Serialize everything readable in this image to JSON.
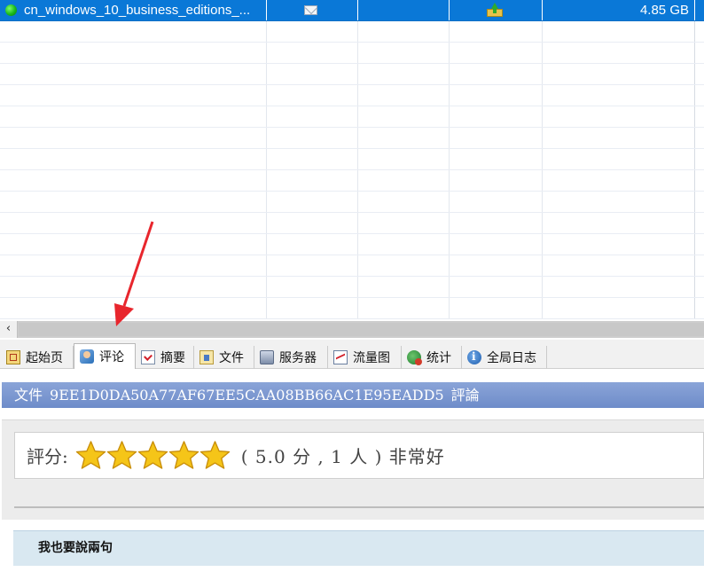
{
  "file_list": {
    "selected_row": {
      "name": "cn_windows_10_business_editions_...",
      "size": "4.85 GB"
    },
    "empty_row_count": 14
  },
  "tabs": [
    {
      "label": "起始页",
      "icon": "home-page-icon",
      "active": false
    },
    {
      "label": "评论",
      "icon": "comment-user-icon",
      "active": true
    },
    {
      "label": "摘要",
      "icon": "summary-checklist-icon",
      "active": false
    },
    {
      "label": "文件",
      "icon": "file-folder-icon",
      "active": false
    },
    {
      "label": "服务器",
      "icon": "server-icon",
      "active": false
    },
    {
      "label": "流量图",
      "icon": "traffic-chart-icon",
      "active": false
    },
    {
      "label": "统计",
      "icon": "statistics-icon",
      "active": false
    },
    {
      "label": "全局日志",
      "icon": "info-log-icon",
      "active": false
    }
  ],
  "content": {
    "header_prefix": "文件",
    "file_hash": "9EE1D0DA50A77AF67EE5CAA08BB66AC1E95EADD5",
    "header_suffix": "評論",
    "rating_label": "評分:",
    "rating_stars": 5,
    "rating_detail": "( 5.0 分 , 1 人 ) 非常好",
    "comment_title": "我也要說兩句"
  },
  "colors": {
    "selection": "#0a78d7",
    "header_bar": "#7b98d0",
    "annotation_arrow": "#e8262d",
    "star": "#f5c518"
  }
}
